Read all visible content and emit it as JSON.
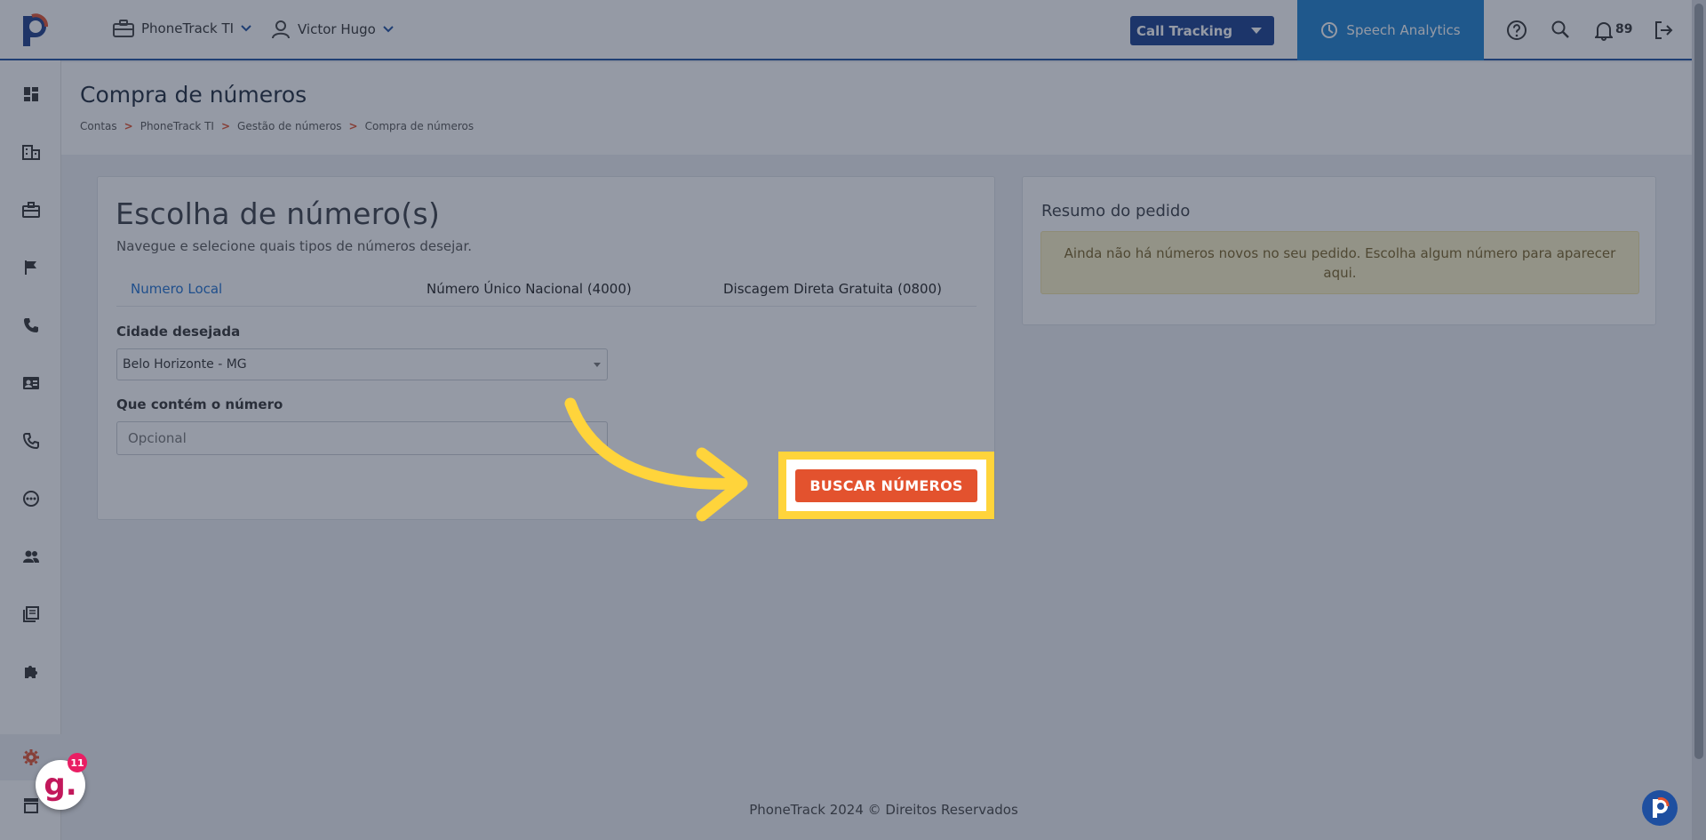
{
  "header": {
    "account_menu": "PhoneTrack TI",
    "user_menu": "Victor Hugo",
    "product_select": "Call Tracking",
    "speech_button": "Speech Analytics",
    "notification_count": "89"
  },
  "sidebar": {
    "icons": [
      "dashboard-icon",
      "building-icon",
      "briefcase-icon",
      "flag-icon",
      "phone-icon",
      "contact-card-icon",
      "phone-alt-icon",
      "dial-icon",
      "users-icon",
      "library-icon",
      "puzzle-icon",
      "settings-icon",
      "store-icon"
    ]
  },
  "page": {
    "title": "Compra de números",
    "breadcrumb": [
      "Contas",
      "PhoneTrack TI",
      "Gestão de números",
      "Compra de números"
    ],
    "breadcrumb_sep": ">"
  },
  "selection": {
    "title": "Escolha de número(s)",
    "subtitle": "Navegue e selecione quais tipos de números desejar.",
    "tabs": [
      "Numero Local",
      "Número Único Nacional (4000)",
      "Discagem Direta Gratuita (0800)"
    ],
    "city_label": "Cidade desejada",
    "city_value": "Belo Horizonte - MG",
    "contains_label": "Que contém o número",
    "contains_placeholder": "Opcional",
    "search_button": "BUSCAR NÚMEROS"
  },
  "summary": {
    "title": "Resumo do pedido",
    "empty_message": "Ainda não há números novos no seu pedido. Escolha algum número para aparecer aqui."
  },
  "footer": {
    "text": "PhoneTrack 2024 © Direitos Reservados"
  },
  "widgets": {
    "g_badge_letter": "g.",
    "g_badge_count": "11"
  },
  "colors": {
    "brand_blue": "#173f8f",
    "speech_blue": "#1e80cf",
    "accent_orange": "#e3522e",
    "highlight_yellow": "#ffd43b"
  }
}
